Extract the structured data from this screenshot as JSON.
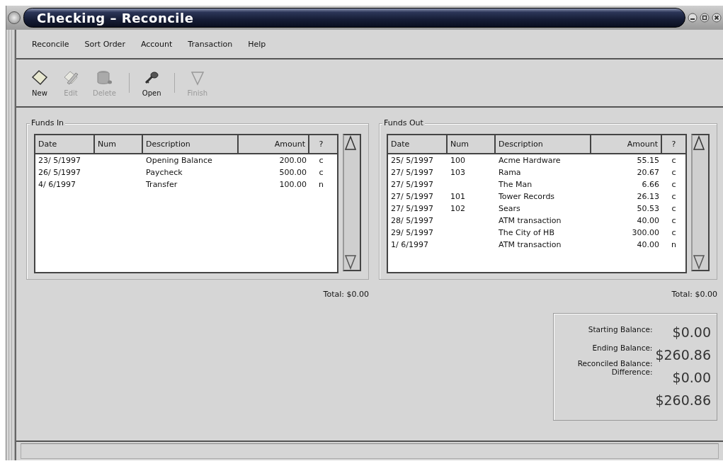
{
  "window": {
    "title": "Checking – Reconcile"
  },
  "menu": [
    "Reconcile",
    "Sort Order",
    "Account",
    "Transaction",
    "Help"
  ],
  "toolbar": [
    {
      "kind": "new",
      "label": "New",
      "disabled": false
    },
    {
      "kind": "edit",
      "label": "Edit",
      "disabled": true
    },
    {
      "kind": "delete",
      "label": "Delete",
      "disabled": true
    },
    {
      "kind": "separator"
    },
    {
      "kind": "open",
      "label": "Open",
      "disabled": false
    },
    {
      "kind": "separator"
    },
    {
      "kind": "finish",
      "label": "Finish",
      "disabled": true
    }
  ],
  "panels": [
    {
      "title": "Funds In",
      "columns": [
        "Date",
        "Num",
        "Description",
        "Amount",
        "?"
      ],
      "rows": [
        {
          "date": "23/ 5/1997",
          "num": "",
          "description": "Opening Balance",
          "amount": "200.00",
          "status": "c"
        },
        {
          "date": "26/ 5/1997",
          "num": "",
          "description": "Paycheck",
          "amount": "500.00",
          "status": "c"
        },
        {
          "date": "4/ 6/1997",
          "num": "",
          "description": "Transfer",
          "amount": "100.00",
          "status": "n"
        }
      ],
      "total": "Total: $0.00"
    },
    {
      "title": "Funds Out",
      "columns": [
        "Date",
        "Num",
        "Description",
        "Amount",
        "?"
      ],
      "rows": [
        {
          "date": "25/ 5/1997",
          "num": "100",
          "description": "Acme Hardware",
          "amount": "55.15",
          "status": "c"
        },
        {
          "date": "27/ 5/1997",
          "num": "103",
          "description": "Rama",
          "amount": "20.67",
          "status": "c"
        },
        {
          "date": "27/ 5/1997",
          "num": "",
          "description": "The Man",
          "amount": "6.66",
          "status": "c"
        },
        {
          "date": "27/ 5/1997",
          "num": "101",
          "description": "Tower Records",
          "amount": "26.13",
          "status": "c"
        },
        {
          "date": "27/ 5/1997",
          "num": "102",
          "description": "Sears",
          "amount": "50.53",
          "status": "c"
        },
        {
          "date": "28/ 5/1997",
          "num": "",
          "description": "ATM transaction",
          "amount": "40.00",
          "status": "c"
        },
        {
          "date": "29/ 5/1997",
          "num": "",
          "description": "The City of HB",
          "amount": "300.00",
          "status": "c"
        },
        {
          "date": "1/ 6/1997",
          "num": "",
          "description": "ATM transaction",
          "amount": "40.00",
          "status": "n"
        }
      ],
      "total": "Total: $0.00"
    }
  ],
  "balance": {
    "labels": [
      "Starting Balance:",
      "Ending Balance:",
      "Reconciled Balance:",
      "Difference:"
    ],
    "values": [
      "$0.00",
      "$260.86",
      "$0.00",
      "$260.86"
    ]
  }
}
